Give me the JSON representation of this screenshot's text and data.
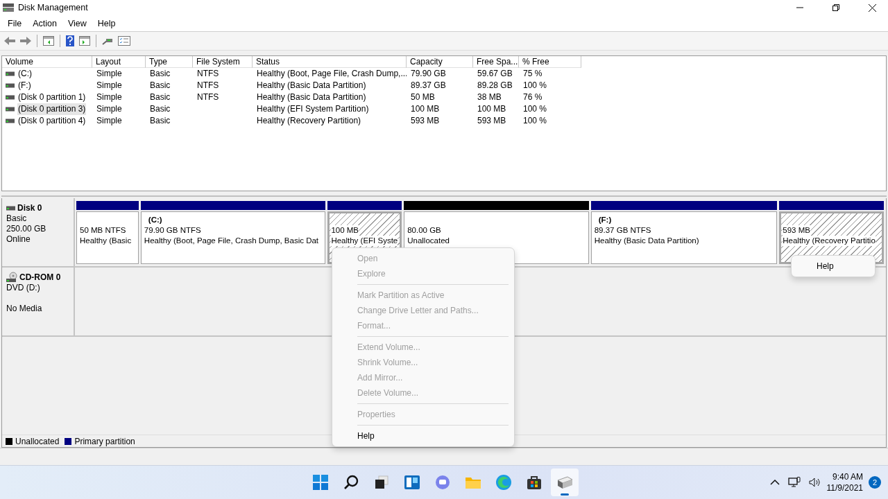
{
  "window": {
    "title": "Disk Management"
  },
  "menu_bar": [
    "File",
    "Action",
    "View",
    "Help"
  ],
  "table": {
    "columns": [
      "Volume",
      "Layout",
      "Type",
      "File System",
      "Status",
      "Capacity",
      "Free Spa...",
      "% Free"
    ],
    "rows": [
      {
        "selected": false,
        "cells": [
          "(C:)",
          "Simple",
          "Basic",
          "NTFS",
          "Healthy (Boot, Page File, Crash Dump,...",
          "79.90 GB",
          "59.67 GB",
          "75 %"
        ]
      },
      {
        "selected": false,
        "cells": [
          "(F:)",
          "Simple",
          "Basic",
          "NTFS",
          "Healthy (Basic Data Partition)",
          "89.37 GB",
          "89.28 GB",
          "100 %"
        ]
      },
      {
        "selected": false,
        "cells": [
          "(Disk 0 partition 1)",
          "Simple",
          "Basic",
          "NTFS",
          "Healthy (Basic Data Partition)",
          "50 MB",
          "38 MB",
          "76 %"
        ]
      },
      {
        "selected": true,
        "cells": [
          "(Disk 0 partition 3)",
          "Simple",
          "Basic",
          "",
          "Healthy (EFI System Partition)",
          "100 MB",
          "100 MB",
          "100 %"
        ]
      },
      {
        "selected": false,
        "cells": [
          "(Disk 0 partition 4)",
          "Simple",
          "Basic",
          "",
          "Healthy (Recovery Partition)",
          "593 MB",
          "593 MB",
          "100 %"
        ]
      }
    ]
  },
  "disks": [
    {
      "kind": "disk",
      "name": "Disk 0",
      "details": [
        "Basic",
        "250.00 GB",
        "Online"
      ],
      "partitions": [
        {
          "kind": "primary",
          "selected": false,
          "size": "50 MB NTFS",
          "status": "Healthy (Basic"
        },
        {
          "kind": "primary",
          "selected": false,
          "label": "(C:)",
          "size": "79.90 GB NTFS",
          "status": "Healthy (Boot, Page File, Crash Dump, Basic Dat"
        },
        {
          "kind": "primary",
          "selected": true,
          "size": "100 MB",
          "status": "Healthy (EFI Syste"
        },
        {
          "kind": "unallocated",
          "selected": false,
          "size": "80.00 GB",
          "status": "Unallocated"
        },
        {
          "kind": "primary",
          "selected": false,
          "label": "(F:)",
          "size": "89.37 GB NTFS",
          "status": "Healthy (Basic Data Partition)"
        },
        {
          "kind": "primary",
          "selected": true,
          "size": "593 MB",
          "status": "Healthy (Recovery Partitio"
        }
      ]
    },
    {
      "kind": "cdrom",
      "name": "CD-ROM 0",
      "details": [
        "DVD (D:)",
        "No Media"
      ]
    }
  ],
  "legend": [
    {
      "label": "Unallocated",
      "color": "#000000"
    },
    {
      "label": "Primary partition",
      "color": "#000080"
    }
  ],
  "context_menu": [
    {
      "kind": "item",
      "label": "Open",
      "disabled": true
    },
    {
      "kind": "item",
      "label": "Explore",
      "disabled": true
    },
    {
      "kind": "separator"
    },
    {
      "kind": "item",
      "label": "Mark Partition as Active",
      "disabled": true
    },
    {
      "kind": "item",
      "label": "Change Drive Letter and Paths...",
      "disabled": true
    },
    {
      "kind": "item",
      "label": "Format...",
      "disabled": true
    },
    {
      "kind": "separator"
    },
    {
      "kind": "item",
      "label": "Extend Volume...",
      "disabled": true
    },
    {
      "kind": "item",
      "label": "Shrink Volume...",
      "disabled": true
    },
    {
      "kind": "item",
      "label": "Add Mirror...",
      "disabled": true
    },
    {
      "kind": "item",
      "label": "Delete Volume...",
      "disabled": true
    },
    {
      "kind": "separator"
    },
    {
      "kind": "item",
      "label": "Properties",
      "disabled": true
    },
    {
      "kind": "separator"
    },
    {
      "kind": "item",
      "label": "Help",
      "disabled": false
    }
  ],
  "popup_menu": [
    {
      "label": "Help",
      "disabled": false
    }
  ],
  "taskbar": {
    "apps": [
      {
        "kind": "start",
        "selected": false
      },
      {
        "kind": "search",
        "selected": false
      },
      {
        "kind": "taskview",
        "selected": false
      },
      {
        "kind": "widgets",
        "selected": false
      },
      {
        "kind": "chat",
        "selected": false
      },
      {
        "kind": "explorer",
        "selected": false
      },
      {
        "kind": "edge",
        "selected": false
      },
      {
        "kind": "store",
        "selected": false
      },
      {
        "kind": "diskmgmt",
        "selected": true
      }
    ],
    "time": "9:40 AM",
    "date": "11/9/2021",
    "notifications": "2"
  }
}
